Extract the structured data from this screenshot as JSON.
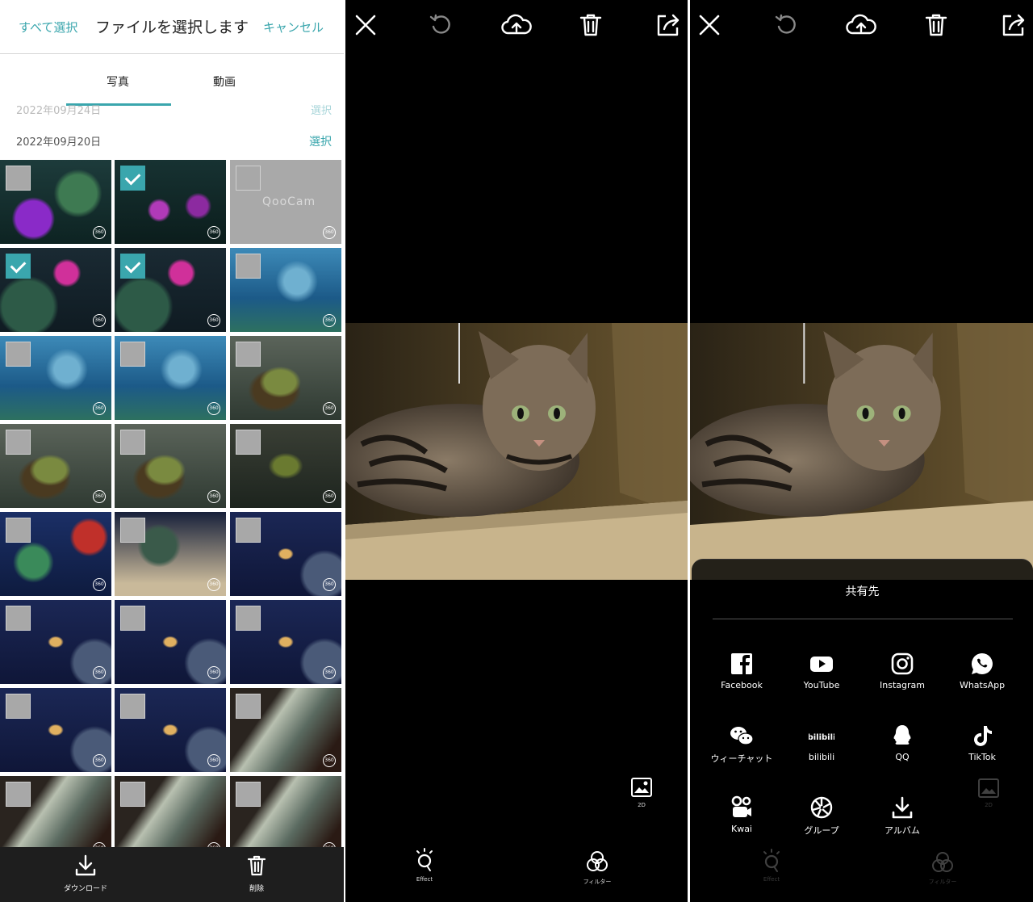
{
  "gallery": {
    "select_all": "すべて選択",
    "title": "ファイルを選択します",
    "cancel": "キャンセル",
    "tabs": [
      {
        "label": "写真",
        "active": true
      },
      {
        "label": "動画",
        "active": false
      }
    ],
    "groups": [
      {
        "date": "2022年09月24日",
        "select": "選択"
      },
      {
        "date": "2022年09月20日",
        "select": "選択"
      }
    ],
    "badge_text": "360",
    "watermark": "QooCam",
    "thumbnails": [
      {
        "checked": false,
        "scene": "reef-purple"
      },
      {
        "checked": true,
        "scene": "reef-purple-dark"
      },
      {
        "checked": false,
        "scene": "placeholder"
      },
      {
        "checked": true,
        "scene": "reef-pink"
      },
      {
        "checked": true,
        "scene": "reef-pink"
      },
      {
        "checked": false,
        "scene": "blue-water"
      },
      {
        "checked": false,
        "scene": "blue-water"
      },
      {
        "checked": false,
        "scene": "blue-water"
      },
      {
        "checked": false,
        "scene": "turtle"
      },
      {
        "checked": false,
        "scene": "turtle"
      },
      {
        "checked": false,
        "scene": "turtle"
      },
      {
        "checked": false,
        "scene": "turtle-dark"
      },
      {
        "checked": false,
        "scene": "coral"
      },
      {
        "checked": false,
        "scene": "coral-dark"
      },
      {
        "checked": false,
        "scene": "deep-fish"
      },
      {
        "checked": false,
        "scene": "deep-fish"
      },
      {
        "checked": false,
        "scene": "deep-fish"
      },
      {
        "checked": false,
        "scene": "deep-fish"
      },
      {
        "checked": false,
        "scene": "deep-fish"
      },
      {
        "checked": false,
        "scene": "deep-fish"
      },
      {
        "checked": false,
        "scene": "rock"
      },
      {
        "checked": false,
        "scene": "rock"
      },
      {
        "checked": false,
        "scene": "rock"
      },
      {
        "checked": false,
        "scene": "rock"
      }
    ],
    "bottom_bar": {
      "download": "ダウンロード",
      "delete": "削除"
    }
  },
  "viewer": {
    "icons": [
      "close-icon",
      "undo-icon",
      "cloud-upload-icon",
      "trash-icon",
      "share-icon"
    ],
    "mode_label": "2D",
    "effect_label": "Effect",
    "filter_label": "フィルター"
  },
  "share": {
    "title": "共有先",
    "targets": [
      {
        "label": "Facebook",
        "icon": "facebook-icon"
      },
      {
        "label": "YouTube",
        "icon": "youtube-icon"
      },
      {
        "label": "Instagram",
        "icon": "instagram-icon"
      },
      {
        "label": "WhatsApp",
        "icon": "whatsapp-icon"
      },
      {
        "label": "ウィーチャット",
        "icon": "wechat-icon"
      },
      {
        "label": "bilibili",
        "icon": "bilibili-icon"
      },
      {
        "label": "QQ",
        "icon": "qq-icon"
      },
      {
        "label": "TikTok",
        "icon": "tiktok-icon"
      },
      {
        "label": "Kwai",
        "icon": "kwai-icon"
      },
      {
        "label": "グループ",
        "icon": "group-icon"
      },
      {
        "label": "アルバム",
        "icon": "album-icon"
      }
    ]
  },
  "colors": {
    "accent": "#3aa6ad",
    "viewer_bg": "#000000",
    "bottom_bar": "#1e1e1e"
  }
}
